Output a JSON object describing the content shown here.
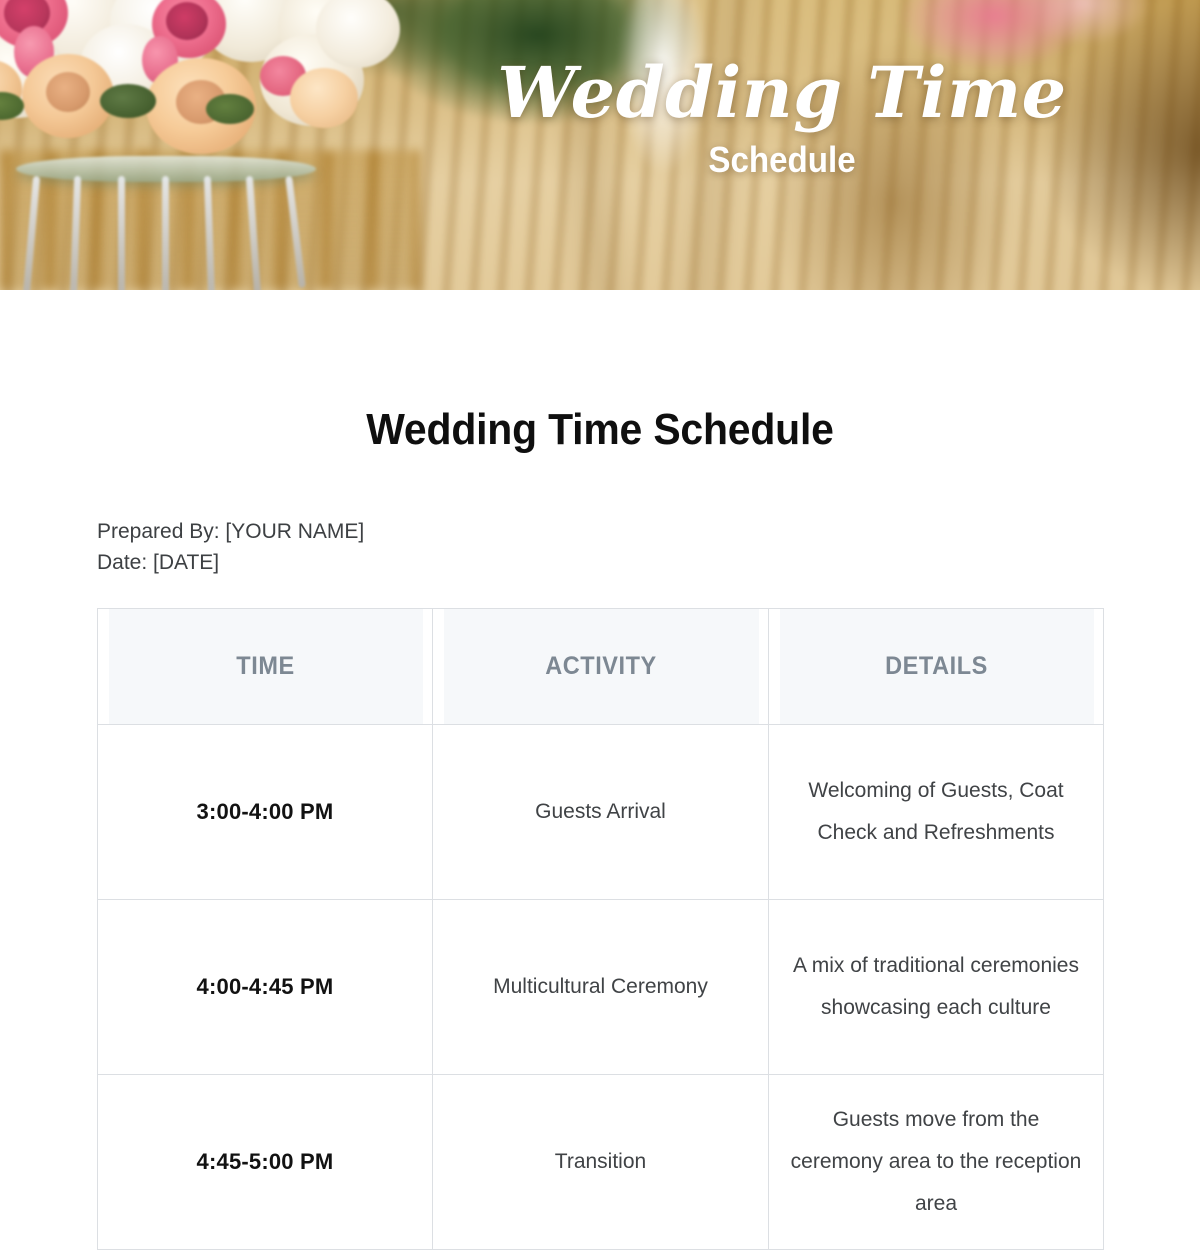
{
  "hero": {
    "title": "Wedding Time",
    "subtitle": "Schedule",
    "image_alt": "wedding-aisle-with-floral-bouquet"
  },
  "document": {
    "title": "Wedding Time Schedule",
    "prepared_by": "Prepared By: [YOUR NAME]",
    "date": "Date: [DATE]"
  },
  "table": {
    "headers": {
      "time": "TIME",
      "activity": "ACTIVITY",
      "details": "DETAILS"
    },
    "rows": [
      {
        "time": "3:00-4:00 PM",
        "activity": "Guests Arrival",
        "details": "Welcoming of Guests, Coat Check and Refreshments"
      },
      {
        "time": "4:00-4:45 PM",
        "activity": "Multicultural Ceremony",
        "details": "A mix of traditional ceremonies showcasing each culture"
      },
      {
        "time": "4:45-5:00 PM",
        "activity": "Transition",
        "details": "Guests move from the ceremony area to the reception area"
      }
    ]
  },
  "colors": {
    "header_text": "#7d8893",
    "header_bg": "#f6f8fa",
    "body_text": "#404346",
    "time_text": "#121212",
    "border": "#dcdfe3",
    "hero_text": "#ffffff"
  }
}
